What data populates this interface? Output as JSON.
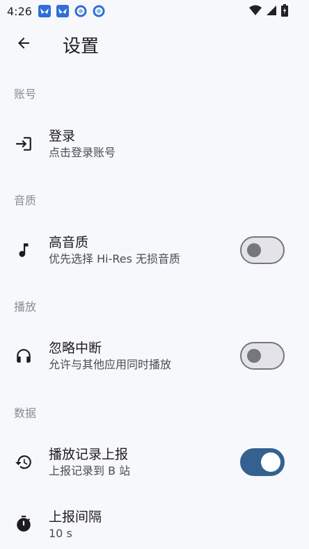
{
  "status_bar": {
    "time": "4:26",
    "notification_icons": [
      "bird-app-icon",
      "bird-app-icon",
      "ring-app-icon",
      "ring-app-icon"
    ],
    "system_icons": [
      "wifi-icon",
      "signal-icon",
      "battery-icon"
    ]
  },
  "app_bar": {
    "back_icon": "arrow-left-icon",
    "title": "设置"
  },
  "sections": {
    "account": {
      "header": "账号",
      "login": {
        "icon": "login-icon",
        "title": "登录",
        "subtitle": "点击登录账号"
      }
    },
    "quality": {
      "header": "音质",
      "hires": {
        "icon": "music-note-icon",
        "title": "高音质",
        "subtitle": "优先选择 Hi-Res 无损音质",
        "enabled": false
      }
    },
    "playback": {
      "header": "播放",
      "ignore_interrupt": {
        "icon": "headphones-icon",
        "title": "忽略中断",
        "subtitle": "允许与其他应用同时播放",
        "enabled": false
      }
    },
    "data": {
      "header": "数据",
      "history_report": {
        "icon": "history-icon",
        "title": "播放记录上报",
        "subtitle": "上报记录到 B 站",
        "enabled": true
      },
      "report_interval": {
        "icon": "timer-icon",
        "title": "上报间隔",
        "subtitle": "10 s"
      }
    }
  },
  "colors": {
    "background": "#f7f8fc",
    "accent": "#34618f",
    "switch_off_outline": "#74777f",
    "section_header": "#8a8c93"
  }
}
